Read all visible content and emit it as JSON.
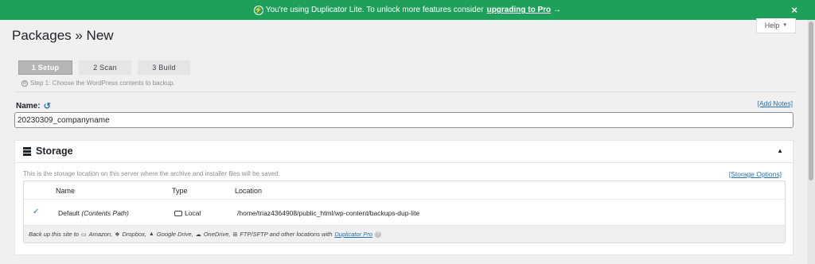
{
  "banner": {
    "text": "You're using Duplicator Lite. To unlock more features consider",
    "link": "upgrading to Pro",
    "arrow": "→",
    "close": "×"
  },
  "header": {
    "title": "Packages » New",
    "help": "Help",
    "help_caret": "▼"
  },
  "steps": [
    {
      "label": "1 Setup",
      "active": true
    },
    {
      "label": "2 Scan",
      "active": false
    },
    {
      "label": "3 Build",
      "active": false
    }
  ],
  "step_description": "Step 1: Choose the WordPress contents to backup.",
  "name_field": {
    "label": "Name:",
    "value": "20230309_companyname",
    "add_notes": "[Add Notes]"
  },
  "storage": {
    "title": "Storage",
    "description": "This is the storage location on this server where the archive and installer files will be saved.",
    "options_link": "[Storage Options]",
    "columns": {
      "name": "Name",
      "type": "Type",
      "location": "Location"
    },
    "row": {
      "check": "✓",
      "name": "Default",
      "name_suffix": "(Contents Path)",
      "type": "Local",
      "location": "/home/triaz4364908/public_html/wp-content/backups-dup-lite"
    },
    "footer": {
      "prefix": "Back up this site to",
      "amazon": "Amazon,",
      "dropbox": "Dropbox,",
      "gdrive": "Google Drive,",
      "onedrive": "OneDrive,",
      "ftp": "FTP/SFTP and other locations with",
      "link": "Duplicator Pro"
    }
  },
  "colors": {
    "banner": "#1fa05a",
    "link": "#2271b1"
  }
}
